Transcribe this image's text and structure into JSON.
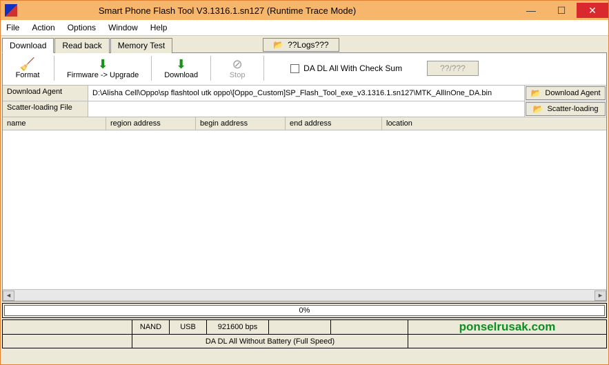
{
  "window": {
    "title": "Smart Phone Flash Tool V3.1316.1.sn127 (Runtime Trace Mode)"
  },
  "menu": {
    "file": "File",
    "action": "Action",
    "options": "Options",
    "window": "Window",
    "help": "Help"
  },
  "tabs": {
    "download": "Download",
    "readback": "Read back",
    "memtest": "Memory Test"
  },
  "logs_button": "??Logs???",
  "toolbar": {
    "format": "Format",
    "firmware_upgrade": "Firmware -> Upgrade",
    "download": "Download",
    "stop": "Stop",
    "checkbox_label": "DA DL All With Check Sum",
    "unknown_button": "??/???"
  },
  "paths": {
    "download_agent_label": "Download Agent",
    "download_agent_value": "D:\\Alisha Cell\\Oppo\\sp flashtool utk oppo\\[Oppo_Custom]SP_Flash_Tool_exe_v3.1316.1.sn127\\MTK_AllInOne_DA.bin",
    "scatter_label": "Scatter-loading File",
    "scatter_value": "",
    "download_agent_button": "Download Agent",
    "scatter_button": "Scatter-loading"
  },
  "table": {
    "cols": {
      "name": "name",
      "region": "region address",
      "begin": "begin address",
      "end": "end address",
      "location": "location"
    }
  },
  "progress": {
    "text": "0%"
  },
  "status": {
    "nand": "NAND",
    "usb": "USB",
    "baud": "921600 bps",
    "mode": "DA DL All Without Battery (Full Speed)",
    "watermark": "ponselrusak.com"
  }
}
